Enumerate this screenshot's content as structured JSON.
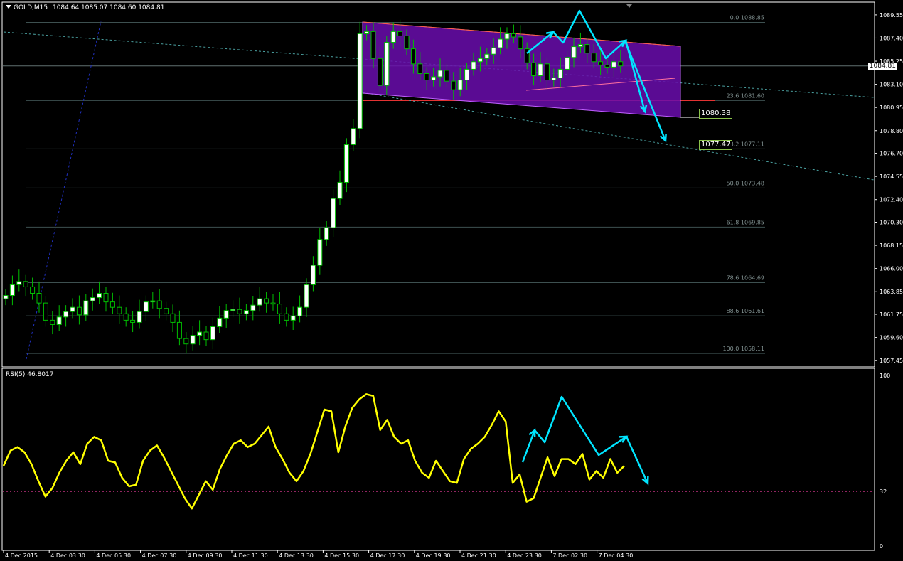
{
  "header": {
    "symbol": "GOLD,M15",
    "ohlc": "1084.64 1085.07 1084.60 1084.81"
  },
  "rsi_header": "RSI(5) 46.8017",
  "current_price": "1084.81",
  "price_axis": [
    "1089.55",
    "1087.40",
    "1085.25",
    "1083.10",
    "1080.95",
    "1078.80",
    "1076.70",
    "1074.55",
    "1072.40",
    "1070.30",
    "1068.15",
    "1066.00",
    "1063.85",
    "1061.75",
    "1059.60",
    "1057.45"
  ],
  "rsi_axis": [
    "100",
    "32",
    "0"
  ],
  "fib_levels": [
    {
      "label": "0.0  1088.85",
      "y": 1088.85
    },
    {
      "label": "23.6  1081.60",
      "y": 1081.6
    },
    {
      "label": "38.2  1077.11",
      "y": 1077.11
    },
    {
      "label": "50.0  1073.48",
      "y": 1073.48
    },
    {
      "label": "61.8  1069.85",
      "y": 1069.85
    },
    {
      "label": "78.6  1064.69",
      "y": 1064.69
    },
    {
      "label": "88.6  1061.61",
      "y": 1061.61
    },
    {
      "label": "100.0  1058.11",
      "y": 1058.11
    }
  ],
  "target_labels": [
    {
      "text": "1080.38",
      "y": 1080.38
    },
    {
      "text": "1077.47",
      "y": 1077.47
    }
  ],
  "time_axis": [
    "4 Dec 2015",
    "4 Dec 03:30",
    "4 Dec 05:30",
    "4 Dec 07:30",
    "4 Dec 09:30",
    "4 Dec 11:30",
    "4 Dec 13:30",
    "4 Dec 15:30",
    "4 Dec 17:30",
    "4 Dec 19:30",
    "4 Dec 21:30",
    "4 Dec 23:30",
    "7 Dec 02:30",
    "7 Dec 04:30"
  ],
  "colors": {
    "bull": "#ffffff",
    "bear": "#000000",
    "wick": "#00c000",
    "rsi": "#ffff00",
    "arrow": "#00e5ff",
    "channel": "#6a0dad",
    "grid": "#2e3a3a"
  },
  "chart_data": {
    "type": "candlestick",
    "ylim": [
      1057.0,
      1090.6
    ],
    "rsi_ylim": [
      0,
      100
    ],
    "candles_close": [
      1063.5,
      1064.5,
      1064.8,
      1064.3,
      1063.7,
      1062.8,
      1061.2,
      1060.8,
      1061.5,
      1062.0,
      1062.4,
      1061.7,
      1063.0,
      1063.3,
      1063.7,
      1062.9,
      1062.4,
      1061.8,
      1061.2,
      1061.0,
      1062.0,
      1062.9,
      1063.0,
      1062.3,
      1061.8,
      1061.0,
      1059.5,
      1059.0,
      1059.8,
      1060.1,
      1059.4,
      1060.6,
      1061.4,
      1062.1,
      1062.2,
      1061.8,
      1062.1,
      1062.6,
      1063.2,
      1062.8,
      1062.7,
      1061.8,
      1061.2,
      1061.6,
      1062.4,
      1064.5,
      1066.3,
      1068.7,
      1069.8,
      1072.5,
      1074.0,
      1077.5,
      1079.0,
      1087.8,
      1088.0,
      1085.5,
      1083.0,
      1087.0,
      1088.0,
      1087.6,
      1086.4,
      1085.0,
      1084.1,
      1083.5,
      1083.8,
      1084.4,
      1083.4,
      1082.6,
      1083.5,
      1084.5,
      1085.2,
      1085.5,
      1085.9,
      1086.5,
      1087.3,
      1087.8,
      1087.5,
      1086.4,
      1085.1,
      1083.9,
      1085.0,
      1083.5,
      1083.7,
      1084.5,
      1085.6,
      1086.6,
      1086.8,
      1086.0,
      1085.2,
      1084.9,
      1084.7,
      1085.2,
      1084.81
    ],
    "rsi": [
      47,
      56,
      58,
      55,
      48,
      38,
      29,
      34,
      43,
      50,
      55,
      48,
      60,
      64,
      62,
      50,
      49,
      40,
      35,
      36,
      50,
      56,
      59,
      52,
      44,
      36,
      28,
      22,
      30,
      38,
      33,
      45,
      53,
      60,
      62,
      58,
      60,
      65,
      70,
      58,
      51,
      43,
      38,
      44,
      54,
      67,
      80,
      79,
      55,
      70,
      81,
      86,
      89,
      88,
      68,
      74,
      64,
      60,
      62,
      50,
      43,
      40,
      50,
      44,
      38,
      37,
      51,
      57,
      60,
      64,
      71,
      79,
      73,
      37,
      42,
      26,
      28,
      40,
      52,
      41,
      51,
      51,
      48,
      54,
      39,
      44,
      40,
      51,
      43,
      47
    ]
  }
}
